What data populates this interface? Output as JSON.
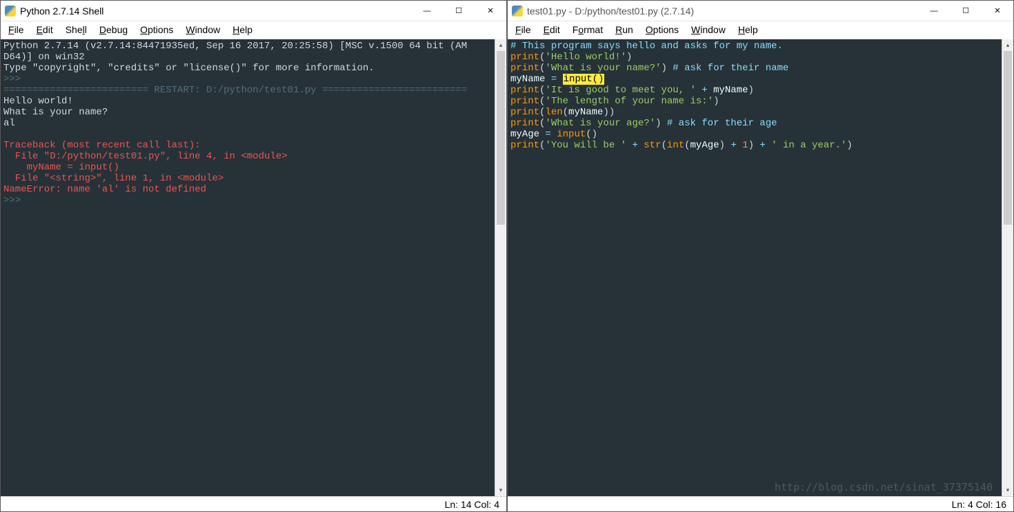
{
  "left": {
    "title": "Python 2.7.14 Shell",
    "controls": {
      "min": "—",
      "max": "☐",
      "close": "✕"
    },
    "menus": [
      "File",
      "Edit",
      "Shell",
      "Debug",
      "Options",
      "Window",
      "Help"
    ],
    "status": "Ln: 14  Col: 4",
    "lines": [
      {
        "t": "py",
        "text": "Python 2.7.14 (v2.7.14:84471935ed, Sep 16 2017, 20:25:58) [MSC v.1500 64 bit (AM"
      },
      {
        "t": "py",
        "text": "D64)] on win32"
      },
      {
        "t": "py",
        "text": "Type \"copyright\", \"credits\" or \"license()\" for more information."
      },
      {
        "t": "prompt",
        "text": ">>> "
      },
      {
        "t": "rest",
        "text": "========================= RESTART: D:/python/test01.py ========================="
      },
      {
        "t": "py",
        "text": "Hello world!"
      },
      {
        "t": "py",
        "text": "What is your name?"
      },
      {
        "t": "py",
        "text": "al"
      },
      {
        "t": "blank",
        "text": ""
      },
      {
        "t": "err",
        "text": "Traceback (most recent call last):"
      },
      {
        "t": "err",
        "text": "  File \"D:/python/test01.py\", line 4, in <module>"
      },
      {
        "t": "err",
        "text": "    myName = input()"
      },
      {
        "t": "err",
        "text": "  File \"<string>\", line 1, in <module>"
      },
      {
        "t": "err",
        "text": "NameError: name 'al' is not defined"
      },
      {
        "t": "prompt",
        "text": ">>> "
      }
    ]
  },
  "right": {
    "title": "test01.py - D:/python/test01.py (2.7.14)",
    "controls": {
      "min": "—",
      "max": "☐",
      "close": "✕"
    },
    "menus": [
      "File",
      "Edit",
      "Format",
      "Run",
      "Options",
      "Window",
      "Help"
    ],
    "status": "Ln: 4  Col: 16",
    "code": {
      "l1": "# This program says hello and asks for my name.",
      "l2": {
        "kw": "print",
        "s": "'Hello world!'"
      },
      "l3": {
        "kw": "print",
        "s": "'What is your name?'",
        "c": "# ask for their name"
      },
      "l4": {
        "v": "myName",
        "eq": " = ",
        "hl": "input()"
      },
      "l5": {
        "kw": "print",
        "s": "'It is good to meet you, '",
        "op": " + ",
        "v": "myName"
      },
      "l6": {
        "kw": "print",
        "s": "'The length of your name is:'"
      },
      "l7": {
        "kw": "print",
        "fn": "len",
        "v": "myName"
      },
      "l8": {
        "kw": "print",
        "s": "'What is your age?'",
        "c": "# ask for their age"
      },
      "l9": {
        "v": "myAge",
        "eq": " = ",
        "fn": "input",
        "paren": "()"
      },
      "l10": {
        "kw": "print",
        "s1": "'You will be '",
        "op1": " + ",
        "fn1": "str",
        "fn2": "int",
        "v": "myAge",
        "op2": " + ",
        "n": "1",
        "op3": " + ",
        "s2": "' in a year.'"
      }
    }
  },
  "watermark": "http://blog.csdn.net/sinat_37375140"
}
